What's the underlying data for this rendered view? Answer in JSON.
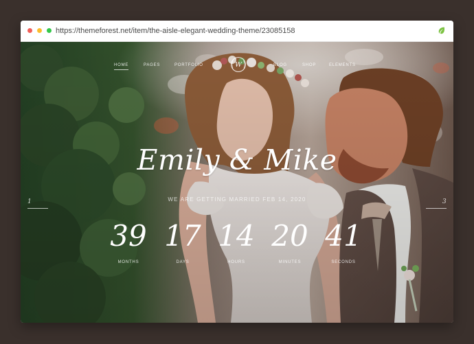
{
  "browser": {
    "url": "https://themeforest.net/item/the-aisle-elegant-wedding-theme/23085158"
  },
  "site": {
    "nav": {
      "items": [
        "HOME",
        "PAGES",
        "PORTFOLIO",
        "BLOG",
        "SHOP",
        "ELEMENTS"
      ]
    },
    "logo_letter": "W",
    "hero": {
      "title": "Emily & Mike",
      "subtitle": "WE ARE GETTING MARRIED FEB 14, 2020",
      "slide_prev": "1",
      "slide_next": "3"
    },
    "countdown": [
      {
        "value": "39",
        "label": "MONTHS"
      },
      {
        "value": "17",
        "label": "DAYS"
      },
      {
        "value": "14",
        "label": "HOURS"
      },
      {
        "value": "20",
        "label": "MINUTES"
      },
      {
        "value": "41",
        "label": "SECONDS"
      }
    ]
  },
  "icons": {
    "leaf": "leaf-icon",
    "logo": "wreath-logo-icon"
  },
  "colors": {
    "background": "#3a302c",
    "window_dot_red": "#f25f58",
    "window_dot_yellow": "#fbbe2e",
    "window_dot_green": "#34c84a",
    "accent_leaf": "#7cc242"
  }
}
